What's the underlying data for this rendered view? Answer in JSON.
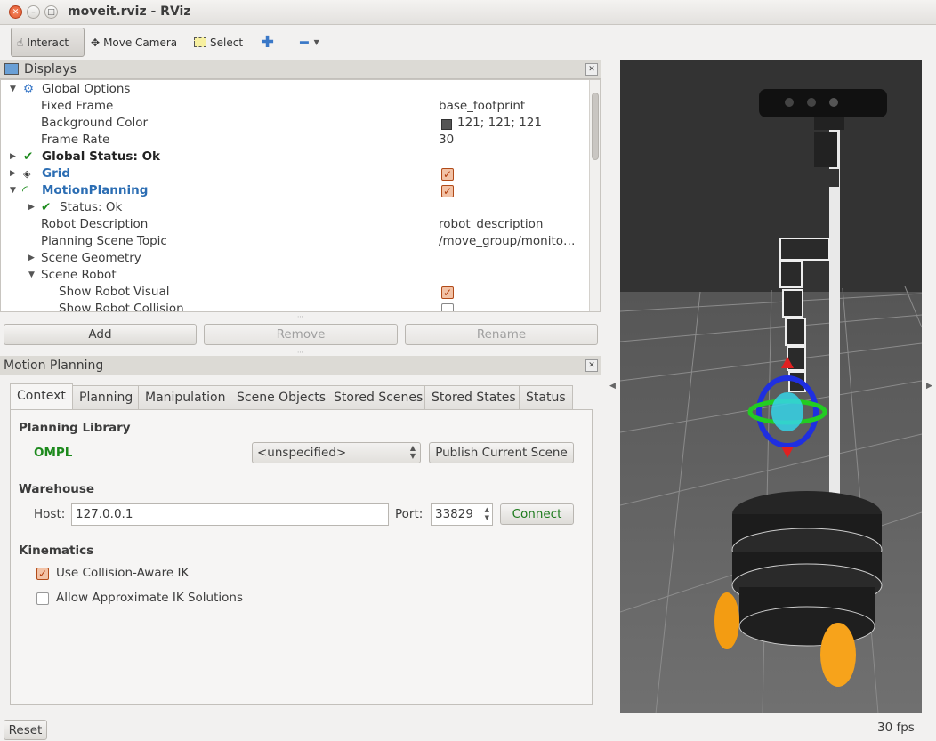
{
  "window": {
    "title": "moveit.rviz - RViz"
  },
  "toolbar": {
    "interact": "Interact",
    "move_camera": "Move Camera",
    "select": "Select"
  },
  "displays": {
    "title": "Displays",
    "rows": [
      {
        "label": "Global Options",
        "value": ""
      },
      {
        "label": "Fixed Frame",
        "value": "base_footprint"
      },
      {
        "label": "Background Color",
        "value": "121; 121; 121"
      },
      {
        "label": "Frame Rate",
        "value": "30"
      },
      {
        "label": "Global Status: Ok",
        "value": ""
      },
      {
        "label": "Grid",
        "value": ""
      },
      {
        "label": "MotionPlanning",
        "value": ""
      },
      {
        "label": "Status: Ok",
        "value": ""
      },
      {
        "label": "Robot Description",
        "value": "robot_description"
      },
      {
        "label": "Planning Scene Topic",
        "value": "/move_group/monito…"
      },
      {
        "label": "Scene Geometry",
        "value": ""
      },
      {
        "label": "Scene Robot",
        "value": ""
      },
      {
        "label": "Show Robot Visual",
        "value": ""
      },
      {
        "label": "Show Robot Collision",
        "value": ""
      }
    ],
    "buttons": {
      "add": "Add",
      "remove": "Remove",
      "rename": "Rename"
    }
  },
  "motion_planning": {
    "title": "Motion Planning",
    "tabs": [
      "Context",
      "Planning",
      "Manipulation",
      "Scene Objects",
      "Stored Scenes",
      "Stored States",
      "Status"
    ],
    "active_tab": "Context",
    "planning_library": {
      "heading": "Planning Library",
      "library": "OMPL",
      "planner": "<unspecified>",
      "publish_button": "Publish Current Scene"
    },
    "warehouse": {
      "heading": "Warehouse",
      "host_label": "Host:",
      "host_value": "127.0.0.1",
      "port_label": "Port:",
      "port_value": "33829",
      "connect_button": "Connect"
    },
    "kinematics": {
      "heading": "Kinematics",
      "collision_aware_ik": {
        "label": "Use Collision-Aware IK",
        "checked": true
      },
      "approx_ik": {
        "label": "Allow Approximate IK Solutions",
        "checked": false
      }
    }
  },
  "statusbar": {
    "reset": "Reset",
    "fps": "30 fps"
  },
  "colors": {
    "background_swatch": "#797979",
    "link_blue": "#2b6db3",
    "ok_green": "#1d8a1d"
  }
}
